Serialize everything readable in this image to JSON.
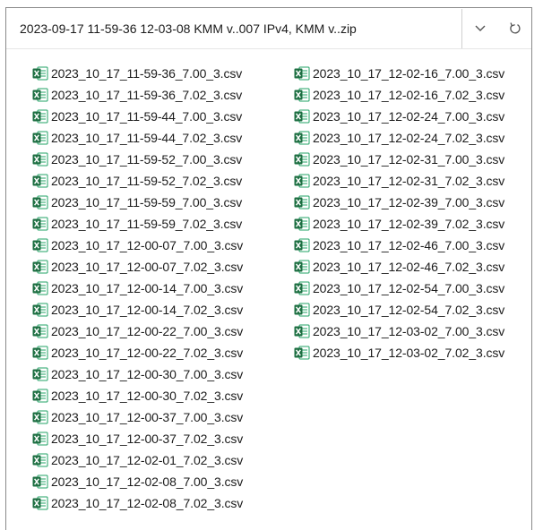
{
  "address": {
    "path": "2023-09-17 11-59-36 12-03-08 KMM v..007 IPv4, KMM v..zip",
    "dropdown_icon": "chevron-down-icon",
    "refresh_icon": "refresh-icon"
  },
  "files": [
    {
      "name": "2023_10_17_11-59-36_7.00_3.csv",
      "icon": "excel-csv-icon"
    },
    {
      "name": "2023_10_17_11-59-36_7.02_3.csv",
      "icon": "excel-csv-icon"
    },
    {
      "name": "2023_10_17_11-59-44_7.00_3.csv",
      "icon": "excel-csv-icon"
    },
    {
      "name": "2023_10_17_11-59-44_7.02_3.csv",
      "icon": "excel-csv-icon"
    },
    {
      "name": "2023_10_17_11-59-52_7.00_3.csv",
      "icon": "excel-csv-icon"
    },
    {
      "name": "2023_10_17_11-59-52_7.02_3.csv",
      "icon": "excel-csv-icon"
    },
    {
      "name": "2023_10_17_11-59-59_7.00_3.csv",
      "icon": "excel-csv-icon"
    },
    {
      "name": "2023_10_17_11-59-59_7.02_3.csv",
      "icon": "excel-csv-icon"
    },
    {
      "name": "2023_10_17_12-00-07_7.00_3.csv",
      "icon": "excel-csv-icon"
    },
    {
      "name": "2023_10_17_12-00-07_7.02_3.csv",
      "icon": "excel-csv-icon"
    },
    {
      "name": "2023_10_17_12-00-14_7.00_3.csv",
      "icon": "excel-csv-icon"
    },
    {
      "name": "2023_10_17_12-00-14_7.02_3.csv",
      "icon": "excel-csv-icon"
    },
    {
      "name": "2023_10_17_12-00-22_7.00_3.csv",
      "icon": "excel-csv-icon"
    },
    {
      "name": "2023_10_17_12-00-22_7.02_3.csv",
      "icon": "excel-csv-icon"
    },
    {
      "name": "2023_10_17_12-00-30_7.00_3.csv",
      "icon": "excel-csv-icon"
    },
    {
      "name": "2023_10_17_12-00-30_7.02_3.csv",
      "icon": "excel-csv-icon"
    },
    {
      "name": "2023_10_17_12-00-37_7.00_3.csv",
      "icon": "excel-csv-icon"
    },
    {
      "name": "2023_10_17_12-00-37_7.02_3.csv",
      "icon": "excel-csv-icon"
    },
    {
      "name": "2023_10_17_12-02-01_7.02_3.csv",
      "icon": "excel-csv-icon"
    },
    {
      "name": "2023_10_17_12-02-08_7.00_3.csv",
      "icon": "excel-csv-icon"
    },
    {
      "name": "2023_10_17_12-02-08_7.02_3.csv",
      "icon": "excel-csv-icon"
    },
    {
      "name": "2023_10_17_12-02-16_7.00_3.csv",
      "icon": "excel-csv-icon"
    },
    {
      "name": "2023_10_17_12-02-16_7.02_3.csv",
      "icon": "excel-csv-icon"
    },
    {
      "name": "2023_10_17_12-02-24_7.00_3.csv",
      "icon": "excel-csv-icon"
    },
    {
      "name": "2023_10_17_12-02-24_7.02_3.csv",
      "icon": "excel-csv-icon"
    },
    {
      "name": "2023_10_17_12-02-31_7.00_3.csv",
      "icon": "excel-csv-icon"
    },
    {
      "name": "2023_10_17_12-02-31_7.02_3.csv",
      "icon": "excel-csv-icon"
    },
    {
      "name": "2023_10_17_12-02-39_7.00_3.csv",
      "icon": "excel-csv-icon"
    },
    {
      "name": "2023_10_17_12-02-39_7.02_3.csv",
      "icon": "excel-csv-icon"
    },
    {
      "name": "2023_10_17_12-02-46_7.00_3.csv",
      "icon": "excel-csv-icon"
    },
    {
      "name": "2023_10_17_12-02-46_7.02_3.csv",
      "icon": "excel-csv-icon"
    },
    {
      "name": "2023_10_17_12-02-54_7.00_3.csv",
      "icon": "excel-csv-icon"
    },
    {
      "name": "2023_10_17_12-02-54_7.02_3.csv",
      "icon": "excel-csv-icon"
    },
    {
      "name": "2023_10_17_12-03-02_7.00_3.csv",
      "icon": "excel-csv-icon"
    },
    {
      "name": "2023_10_17_12-03-02_7.02_3.csv",
      "icon": "excel-csv-icon"
    }
  ],
  "colors": {
    "excel_green": "#1d6f42",
    "excel_light": "#21a366",
    "text": "#1b1b1b"
  }
}
